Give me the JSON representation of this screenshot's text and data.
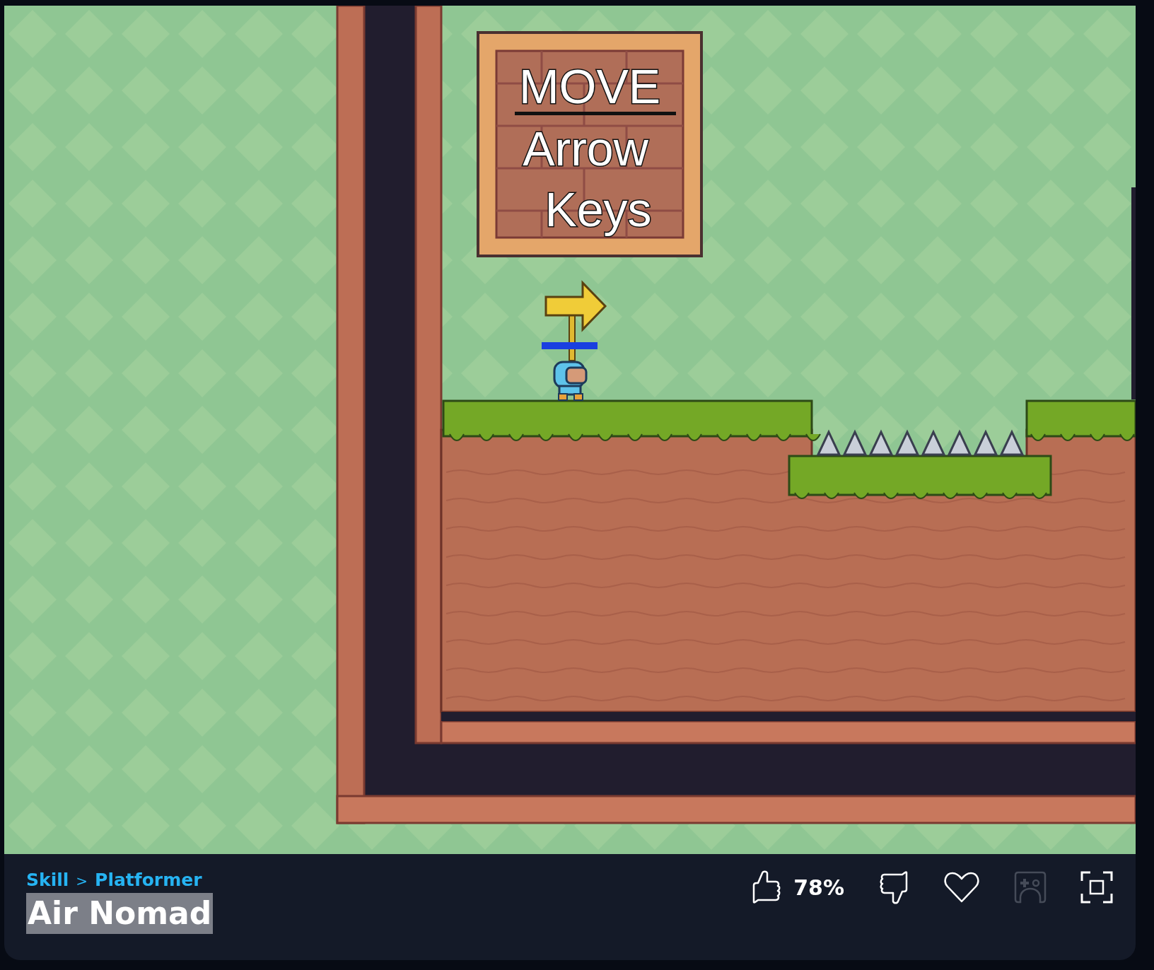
{
  "game": {
    "sign": {
      "lines": [
        "MOVE",
        "Arrow",
        "Keys"
      ]
    }
  },
  "breadcrumb": {
    "items": [
      {
        "label": "Skill"
      },
      {
        "label": "Platformer"
      }
    ],
    "separator": ">"
  },
  "title": {
    "text": "Air Nomad",
    "highlighted": true
  },
  "actions": [
    {
      "kind": "like",
      "label": "78%",
      "disabled": false
    },
    {
      "kind": "dislike",
      "disabled": false
    },
    {
      "kind": "favorite",
      "disabled": false
    },
    {
      "kind": "controller",
      "disabled": true
    },
    {
      "kind": "fullscreen",
      "disabled": false
    }
  ]
}
